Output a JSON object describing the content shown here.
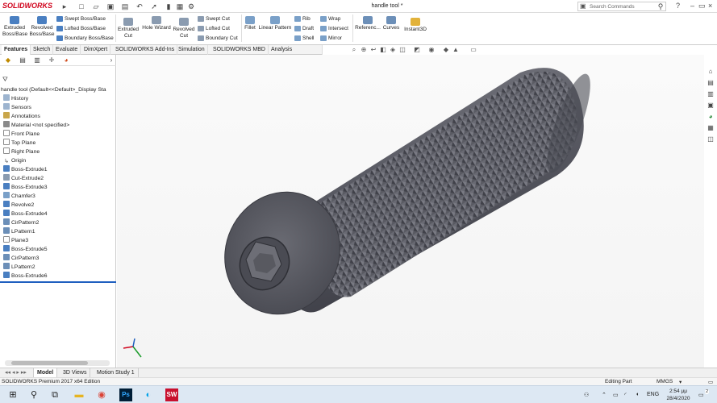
{
  "app": {
    "logo": "SOLIDWORKS",
    "document_title": "handle tool *",
    "search_placeholder": "Search Commands",
    "window_controls": [
      "?",
      "–",
      "▭",
      "×"
    ]
  },
  "ribbon": {
    "extruded_boss": "Extruded Boss/Base",
    "revolved_boss": "Revolved Boss/Base",
    "swept_boss": "Swept Boss/Base",
    "lofted_boss": "Lofted Boss/Base",
    "boundary_boss": "Boundary Boss/Base",
    "extruded_cut": "Extruded Cut",
    "hole_wizard": "Hole Wizard",
    "revolved_cut": "Revolved Cut",
    "swept_cut": "Swept Cut",
    "lofted_cut": "Lofted Cut",
    "boundary_cut": "Boundary Cut",
    "fillet": "Fillet",
    "linear_pattern": "Linear Pattern",
    "rib": "Rib",
    "draft": "Draft",
    "shell": "Shell",
    "wrap": "Wrap",
    "intersect": "Intersect",
    "mirror": "Mirror",
    "reference": "Referenc...",
    "curves": "Curves",
    "instant3d": "Instant3D"
  },
  "tabs": [
    "Features",
    "Sketch",
    "Evaluate",
    "DimXpert",
    "SOLIDWORKS Add-Ins",
    "Simulation",
    "SOLIDWORKS MBD",
    "Analysis Preparation"
  ],
  "active_tab": "Features",
  "tree": {
    "root": "handle tool  (Default<<Default>_Display Sta",
    "items": [
      "History",
      "Sensors",
      "Annotations",
      "Material <not specified>",
      "Front Plane",
      "Top Plane",
      "Right Plane",
      "Origin",
      "Boss-Extrude1",
      "Cut-Extrude2",
      "Boss-Extrude3",
      "Chamfer3",
      "Revolve2",
      "Boss-Extrude4",
      "CirPattern2",
      "LPattern1",
      "Plane3",
      "Boss-Extrude5",
      "CirPattern3",
      "LPattern2",
      "Boss-Extrude6"
    ]
  },
  "bottom_tabs": [
    "Model",
    "3D Views",
    "Motion Study 1"
  ],
  "active_bottom_tab": "Model",
  "status": {
    "edition": "SOLIDWORKS Premium 2017 x64 Edition",
    "mode": "Editing Part",
    "units": "MMGS"
  },
  "taskbar": {
    "language": "ENG",
    "time": "2:54 μμ",
    "date": "28/4/2020",
    "notification_count": "2"
  },
  "colors": {
    "brand_red": "#d0021b",
    "model_gray": "#5f5f66",
    "rollback_blue": "#1f5fbf",
    "taskbar_bg": "#dde8f3"
  }
}
